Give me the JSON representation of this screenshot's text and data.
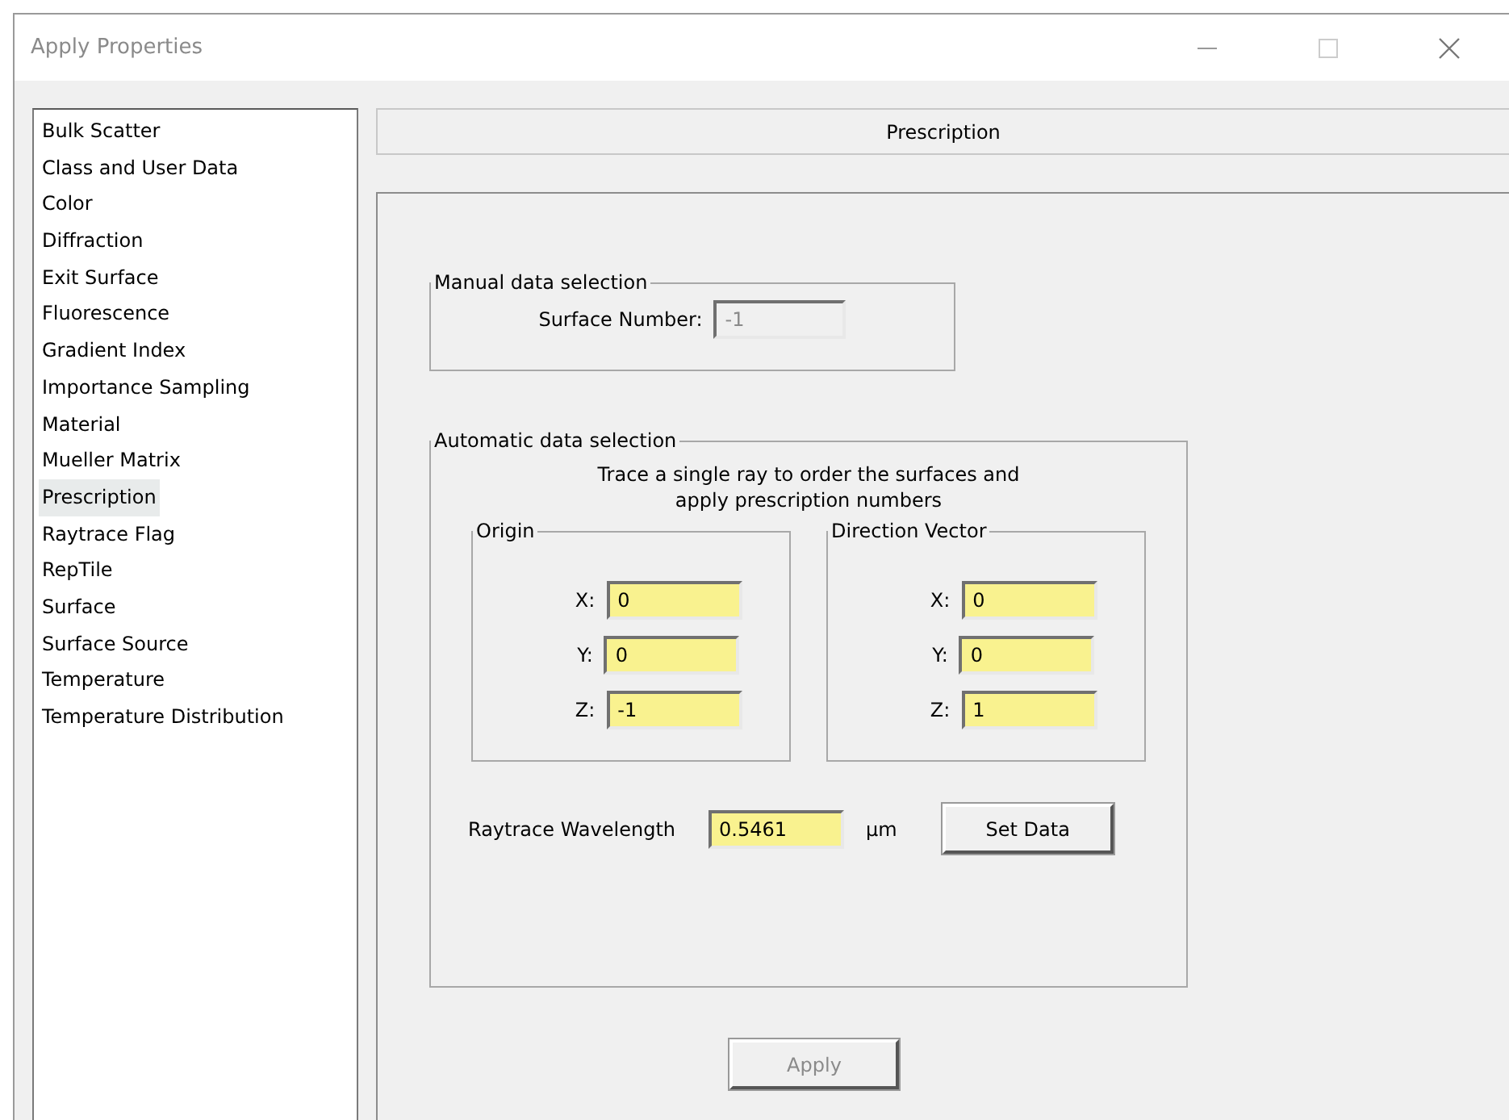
{
  "window": {
    "title": "Apply Properties"
  },
  "categories": [
    {
      "label": "Bulk Scatter",
      "selected": false
    },
    {
      "label": "Class and User Data",
      "selected": false
    },
    {
      "label": "Color",
      "selected": false
    },
    {
      "label": "Diffraction",
      "selected": false
    },
    {
      "label": "Exit Surface",
      "selected": false
    },
    {
      "label": "Fluorescence",
      "selected": false
    },
    {
      "label": "Gradient Index",
      "selected": false
    },
    {
      "label": "Importance Sampling",
      "selected": false
    },
    {
      "label": "Material",
      "selected": false
    },
    {
      "label": "Mueller Matrix",
      "selected": false
    },
    {
      "label": "Prescription",
      "selected": true
    },
    {
      "label": "Raytrace Flag",
      "selected": false
    },
    {
      "label": "RepTile",
      "selected": false
    },
    {
      "label": "Surface",
      "selected": false
    },
    {
      "label": "Surface Source",
      "selected": false
    },
    {
      "label": "Temperature",
      "selected": false
    },
    {
      "label": "Temperature Distribution",
      "selected": false
    }
  ],
  "panel_title": "Prescription",
  "manual": {
    "legend": "Manual data selection",
    "surface_label": "Surface Number:",
    "surface_value": "-1",
    "disabled": true
  },
  "automatic": {
    "legend": "Automatic data selection",
    "description_lines": [
      "Trace a single ray to order the surfaces and",
      "apply prescription numbers"
    ],
    "groups": [
      {
        "legend": "Origin",
        "fields": [
          {
            "label": "X:",
            "value": "0"
          },
          {
            "label": "Y:",
            "value": "0"
          },
          {
            "label": "Z:",
            "value": "-1"
          }
        ]
      },
      {
        "legend": "Direction Vector",
        "fields": [
          {
            "label": "X:",
            "value": "0"
          },
          {
            "label": "Y:",
            "value": "0"
          },
          {
            "label": "Z:",
            "value": "1"
          }
        ]
      }
    ],
    "wavelength": {
      "label": "Raytrace Wavelength",
      "value": "0.5461",
      "unit": "µm"
    },
    "set_data_button": "Set Data"
  },
  "apply_button": {
    "label": "Apply",
    "disabled": true
  }
}
